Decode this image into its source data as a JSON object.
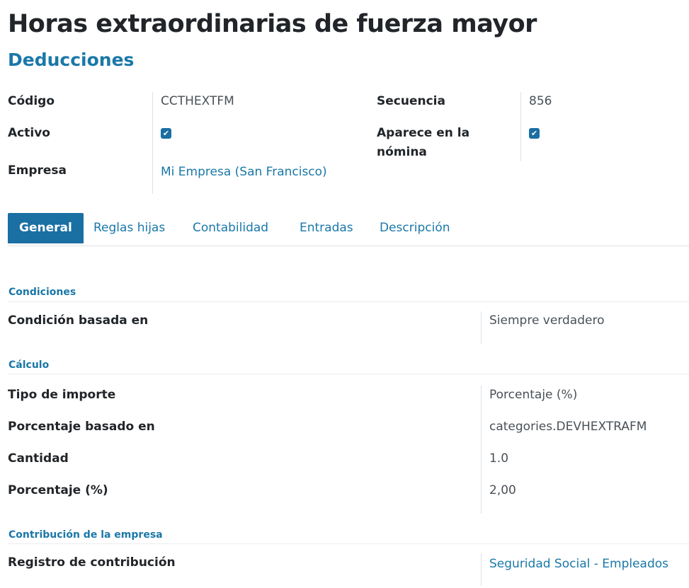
{
  "header": {
    "title": "Horas extraordinarias de fuerza mayor",
    "category": "Deducciones"
  },
  "fields": {
    "codigo": {
      "label": "Código",
      "value": "CCTHEXTFM"
    },
    "activo": {
      "label": "Activo",
      "checked": true
    },
    "empresa": {
      "label": "Empresa",
      "value": "Mi Empresa (San Francisco)"
    },
    "secuencia": {
      "label": "Secuencia",
      "value": "856"
    },
    "aparece": {
      "label_line1": "Aparece en la",
      "label_line2": "nómina",
      "checked": true
    }
  },
  "tabs": [
    {
      "label": "General",
      "active": true
    },
    {
      "label": "Reglas hijas",
      "active": false
    },
    {
      "label": "Contabilidad",
      "active": false
    },
    {
      "label": "Entradas",
      "active": false
    },
    {
      "label": "Descripción",
      "active": false
    }
  ],
  "sections": {
    "condiciones": {
      "title": "Condiciones",
      "rows": [
        {
          "label": "Condición basada en",
          "value": "Siempre verdadero"
        }
      ]
    },
    "calculo": {
      "title": "Cálculo",
      "rows": [
        {
          "label": "Tipo de importe",
          "value": "Porcentaje (%)"
        },
        {
          "label": "Porcentaje basado en",
          "value": "categories.DEVHEXTRAFM"
        },
        {
          "label": "Cantidad",
          "value": "1.0"
        },
        {
          "label": "Porcentaje (%)",
          "value": "2,00"
        }
      ]
    },
    "contribucion": {
      "title": "Contribución de la empresa",
      "rows": [
        {
          "label": "Registro de contribución",
          "value": "Seguridad Social - Empleados"
        }
      ]
    }
  },
  "colors": {
    "accent": "#1a78a8",
    "tab_active_bg": "#1a6fa3",
    "text": "#212529"
  },
  "icons": {
    "checkbox": "checkbox-checked-icon"
  }
}
